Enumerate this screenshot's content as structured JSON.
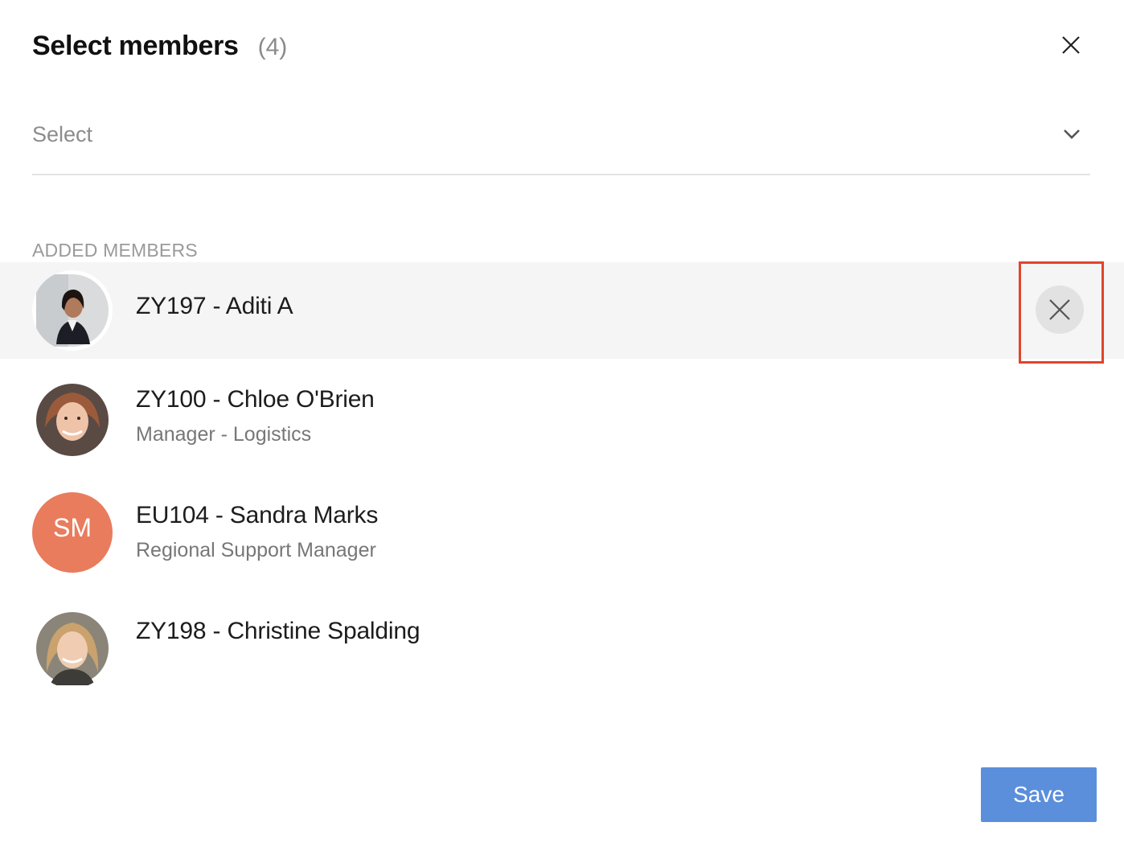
{
  "dialog": {
    "title": "Select members",
    "count": "(4)",
    "close_icon": "close-icon"
  },
  "select": {
    "placeholder": "Select",
    "icon": "chevron-down-icon"
  },
  "section": {
    "label": "ADDED MEMBERS"
  },
  "members": [
    {
      "name": "ZY197 - Aditi A",
      "role": "",
      "avatar": "photo"
    },
    {
      "name": "ZY100 - Chloe O'Brien",
      "role": "Manager - Logistics",
      "avatar": "photo"
    },
    {
      "name": "EU104 - Sandra Marks",
      "role": "Regional Support Manager",
      "avatar": "SM"
    },
    {
      "name": "ZY198 - Christine Spalding",
      "role": "",
      "avatar": "photo"
    }
  ],
  "remove": {
    "icon": "close-icon"
  },
  "footer": {
    "save_label": "Save"
  },
  "colors": {
    "accent": "#5b8fdc",
    "initials_avatar": "#e87c5d",
    "highlight_row": "#f5f5f5",
    "focus_outline": "#e0452b"
  }
}
